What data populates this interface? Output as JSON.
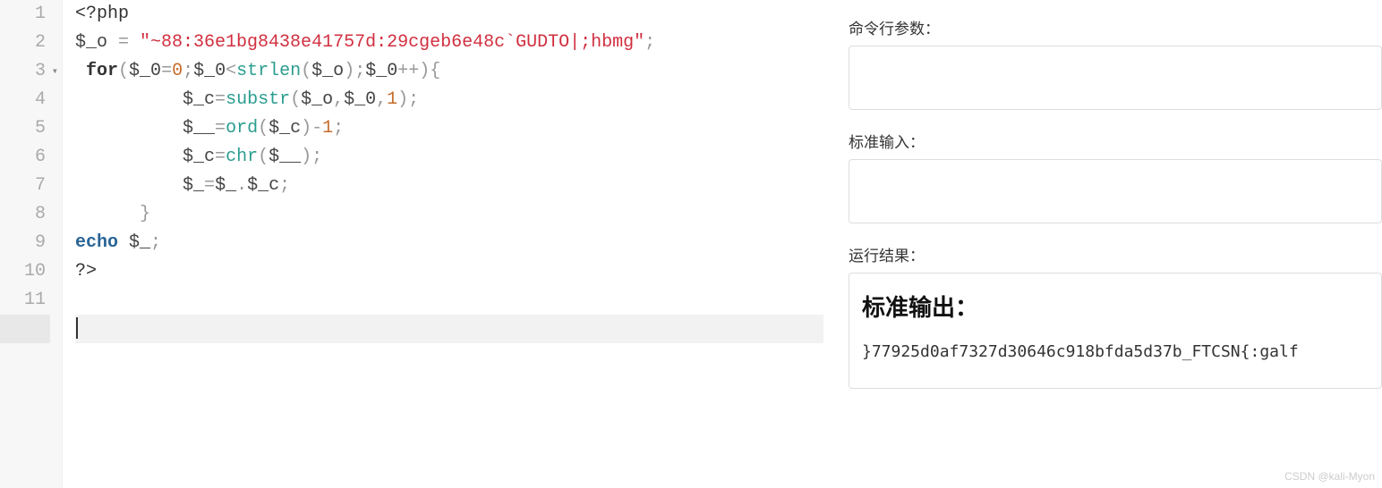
{
  "editor": {
    "line_count": 12,
    "active_line": 12,
    "fold_line": 3,
    "code": {
      "l1": {
        "meta": "<?php"
      },
      "l2": {
        "var": "$_o",
        "eq": " = ",
        "str": "\"~88:36e1bg8438e41757d:29cgeb6e48c`GUDTO|;hbmg\"",
        "semi": ";"
      },
      "l3": {
        "kw": "for",
        "open": "(",
        "v1": "$_0",
        "eq": "=",
        "num": "0",
        "semi1": ";",
        "v2": "$_0",
        "lt": "<",
        "fn": "strlen",
        "po": "(",
        "vo": "$_o",
        "pc": ")",
        "semi2": ";",
        "v3": "$_0",
        "inc": "++",
        "close": "){"
      },
      "l4": {
        "v": "$_c",
        "eq": "=",
        "fn": "substr",
        "po": "(",
        "a1": "$_o",
        "c1": ",",
        "a2": "$_0",
        "c2": ",",
        "num": "1",
        "pc": ");"
      },
      "l5": {
        "v": "$__",
        "eq": "=",
        "fn": "ord",
        "po": "(",
        "a1": "$_c",
        "pc": ")",
        "op": "-",
        "num": "1",
        "semi": ";"
      },
      "l6": {
        "v": "$_c",
        "eq": "=",
        "fn": "chr",
        "po": "(",
        "a1": "$__",
        "pc": ");"
      },
      "l7": {
        "v1": "$_",
        "eq": "=",
        "v2": "$_",
        "dot": ".",
        "v3": "$_c",
        "semi": ";"
      },
      "l8": {
        "brace": "}"
      },
      "l9": {
        "kw": "echo",
        "sp": " ",
        "v": "$_",
        "semi": ";"
      },
      "l10": {
        "meta": "?>"
      }
    }
  },
  "panel": {
    "args_label": "命令行参数：",
    "args_value": "",
    "stdin_label": "标准输入：",
    "stdin_value": "",
    "result_label": "运行结果：",
    "stdout_heading": "标准输出：",
    "stdout_text": "}77925d0af7327d30646c918bfda5d37b_FTCSN{:galf"
  },
  "watermark": "CSDN @kali-Myon"
}
